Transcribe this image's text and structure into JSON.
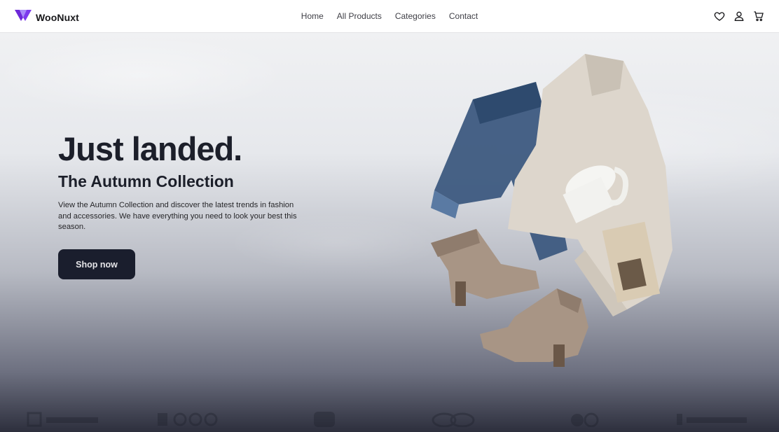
{
  "brand": {
    "name": "WooNuxt",
    "logo_colors": [
      "#7c3aed",
      "#a78bfa"
    ]
  },
  "nav": {
    "items": [
      {
        "label": "Home"
      },
      {
        "label": "All Products"
      },
      {
        "label": "Categories"
      },
      {
        "label": "Contact"
      }
    ]
  },
  "header_icons": [
    "heart-icon",
    "user-icon",
    "cart-icon"
  ],
  "hero": {
    "title": "Just landed.",
    "subtitle": "The Autumn Collection",
    "description": "View the Autumn Collection and discover the latest trends in fashion and accessories. We have everything you need to look your best this season.",
    "cta_label": "Shop now"
  },
  "partner_logos": [
    "partner-logo-1",
    "partner-logo-2",
    "partner-logo-3",
    "partner-logo-4",
    "partner-logo-5",
    "partner-logo-6"
  ],
  "colors": {
    "accent": "#7c3aed",
    "button_bg": "#1a1e2d",
    "text_dark": "#1c1f2a"
  }
}
